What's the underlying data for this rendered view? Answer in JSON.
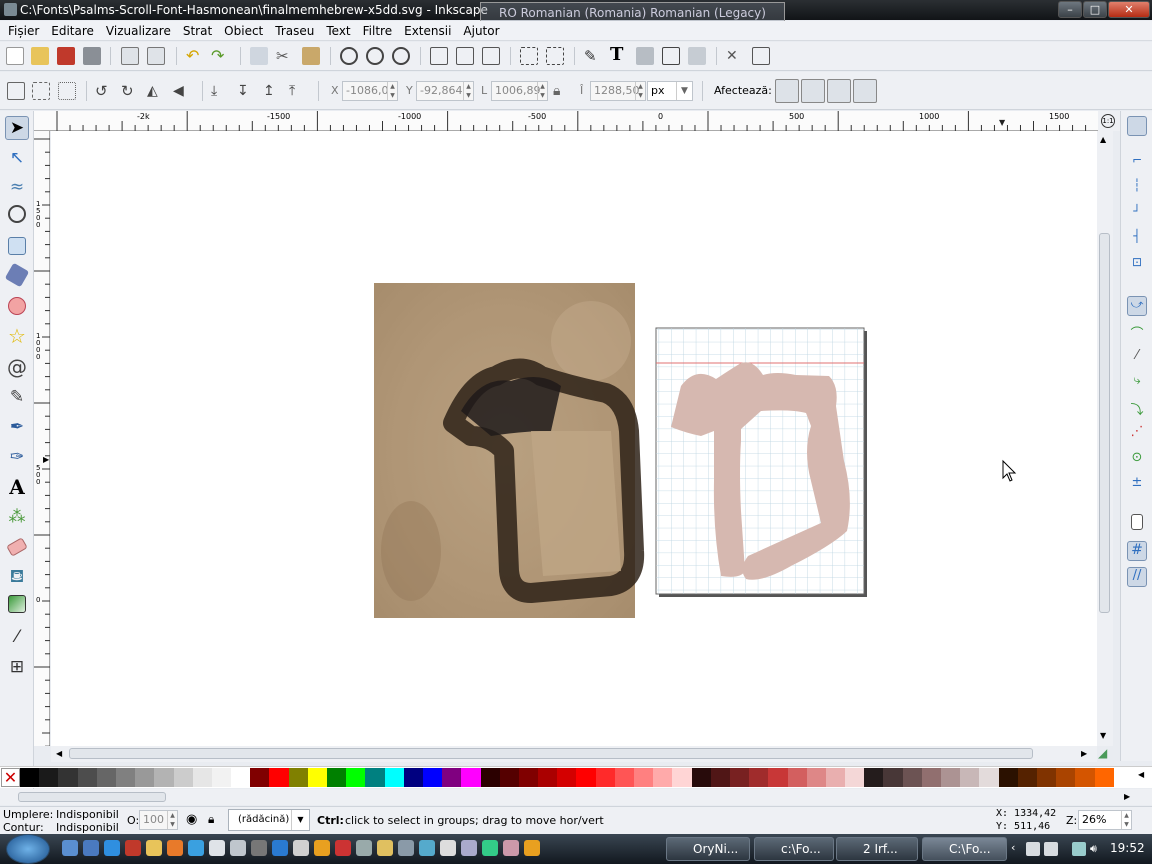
{
  "window": {
    "title": "C:\\Fonts\\Psalms-Scroll-Font-Hasmonean\\finalmemhebrew-x5dd.svg - Inkscape",
    "language_bar": "RO Romanian (Romania)   Romanian (Legacy)",
    "minimize": "–",
    "maximize": "□",
    "close": "✕"
  },
  "menu": [
    "Fișier",
    "Editare",
    "Vizualizare",
    "Strat",
    "Obiect",
    "Traseu",
    "Text",
    "Filtre",
    "Extensii",
    "Ajutor"
  ],
  "select_toolbar": {
    "x_label": "X",
    "x_value": "-1086,0",
    "y_label": "Y",
    "y_value": "-92,864",
    "w_label": "L",
    "w_value": "1006,89",
    "h_label": "Î",
    "h_value": "1288,50",
    "unit": "px",
    "affects_label": "Afectează:"
  },
  "ruler_labels": [
    "-2k",
    "-1500",
    "-1000",
    "-500",
    "0",
    "500",
    "1000",
    "1500"
  ],
  "ruler_vertical_labels": [
    "1500",
    "1000",
    "500",
    "0"
  ],
  "colors": {
    "accent": "#2f6fc0",
    "glyph": "#d6b8b0",
    "grid": "#b9d3e0",
    "baseline": "#e07070"
  },
  "palette": [
    "#000000",
    "#1a1a1a",
    "#333333",
    "#4d4d4d",
    "#666666",
    "#808080",
    "#999999",
    "#b3b3b3",
    "#cccccc",
    "#e6e6e6",
    "#f2f2f2",
    "#ffffff",
    "#800000",
    "#ff0000",
    "#808000",
    "#ffff00",
    "#008000",
    "#00ff00",
    "#008080",
    "#00ffff",
    "#000080",
    "#0000ff",
    "#800080",
    "#ff00ff",
    "#2b0000",
    "#550000",
    "#800000",
    "#aa0000",
    "#d40000",
    "#ff0000",
    "#ff2a2a",
    "#ff5555",
    "#ff8080",
    "#ffaaaa",
    "#ffd5d5",
    "#280b0b",
    "#501616",
    "#782121",
    "#a02c2c",
    "#c83737",
    "#d35f5f",
    "#de8787",
    "#e9afaf",
    "#f4d7d7",
    "#241c1c",
    "#483737",
    "#6c5353",
    "#916f6f",
    "#ac9393",
    "#c8b7b7",
    "#e3dbdb",
    "#2b1100",
    "#552200",
    "#803300",
    "#aa4400",
    "#d45500",
    "#ff6600"
  ],
  "status": {
    "fill_label": "Umplere:",
    "fill_value": "Indisponibil",
    "stroke_label": "Contur:",
    "stroke_value": "Indisponibil",
    "opacity_label": "O:",
    "opacity_value": "100",
    "layer": "(rădăcină)",
    "message_bold": "Ctrl:",
    "message": "click to select in groups; drag to move hor/vert",
    "coord_x": "X: 1334,42",
    "coord_y": "Y:  511,46",
    "zoom_label": "Z:",
    "zoom_value": "26%"
  },
  "taskbar": {
    "tasks": [
      "OryNi...",
      "c:\\Fo...",
      "2 Irf...",
      "C:\\Fo..."
    ],
    "clock": "19:52"
  }
}
